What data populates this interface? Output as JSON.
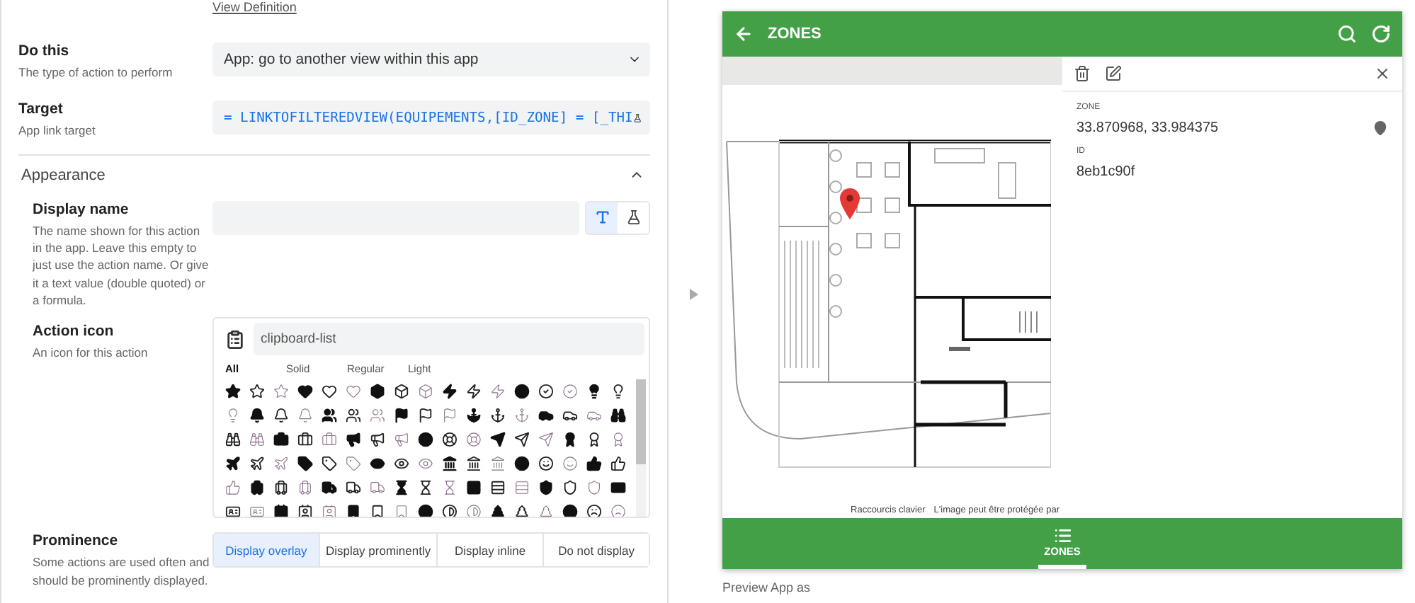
{
  "editor": {
    "view_definition_link": "View Definition",
    "fields": [
      {
        "kind": "select",
        "label": "Do this",
        "description": "The type of action to perform",
        "value": "App: go to another view within this app"
      },
      {
        "kind": "formula",
        "label": "Target",
        "description": "App link target",
        "value": "= LINKTOFILTEREDVIEW(EQUIPEMENTS,[ID_ZONE] = [_THI"
      }
    ],
    "appearance": {
      "title": "Appearance",
      "expanded": true,
      "display_name": {
        "label": "Display name",
        "description": "The name shown for this action in the app. Leave this empty to just use the action name. Or give it a text value (double quoted) or a formula.",
        "modes": [
          {
            "kind": "text",
            "selected": true
          },
          {
            "kind": "formula",
            "selected": false
          }
        ]
      },
      "action_icon": {
        "label": "Action icon",
        "description": "An icon for this action",
        "search_value": "clipboard-list",
        "filters": [
          {
            "label": "All",
            "selected": true
          },
          {
            "label": "Solid",
            "selected": false
          },
          {
            "label": "Regular",
            "selected": false
          },
          {
            "label": "Light",
            "selected": false
          }
        ]
      },
      "prominence": {
        "label": "Prominence",
        "description": "Some actions are used often and should be prominently displayed.",
        "options": [
          {
            "label": "Display overlay",
            "selected": true
          },
          {
            "label": "Display prominently",
            "selected": false
          },
          {
            "label": "Display inline",
            "selected": false
          },
          {
            "label": "Do not display",
            "selected": false
          }
        ]
      }
    }
  },
  "preview": {
    "title": "ZONES",
    "map_footer": [
      "Raccourcis clavier",
      "L'image peut être protégée par"
    ],
    "detail": {
      "fields": [
        {
          "label": "ZONE",
          "value": "33.870968, 33.984375"
        },
        {
          "label": "ID",
          "value": "8eb1c90f"
        }
      ]
    },
    "nav": [
      {
        "label": "ZONES",
        "selected": true
      }
    ],
    "preview_as": "Preview App as"
  }
}
